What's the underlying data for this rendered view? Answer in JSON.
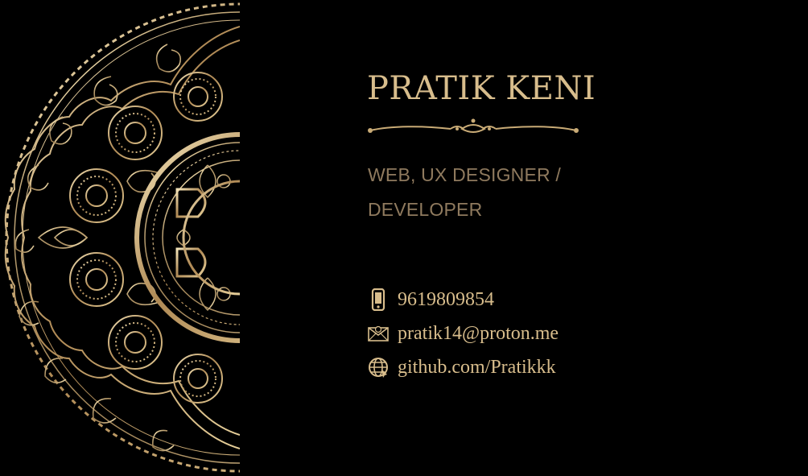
{
  "card": {
    "name": "PRATIK KENI",
    "role_line1": "WEB, UX DESIGNER /",
    "role_line2": "DEVELOPER"
  },
  "contacts": {
    "phone": "9619809854",
    "email": "pratik14@proton.me",
    "website": "github.com/Pratikkk"
  },
  "icons": {
    "phone": "mobile-phone-icon",
    "email": "envelope-icon",
    "website": "globe-icon"
  },
  "colors": {
    "background": "#000000",
    "gold": "#d8bd8c",
    "muted_gold": "#8f7a5e"
  }
}
